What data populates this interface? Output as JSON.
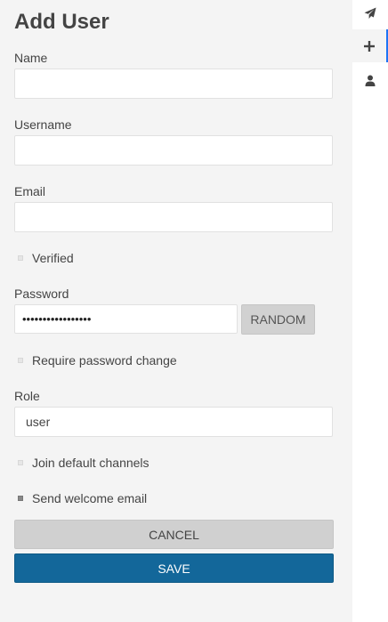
{
  "panel": {
    "title": "Add User",
    "fields": {
      "name": {
        "label": "Name",
        "value": ""
      },
      "username": {
        "label": "Username",
        "value": ""
      },
      "email": {
        "label": "Email",
        "value": ""
      },
      "password": {
        "label": "Password",
        "value": "•••••••••••••••••"
      },
      "role": {
        "label": "Role",
        "value": "user"
      }
    },
    "checkboxes": {
      "verified": {
        "label": "Verified",
        "checked": false
      },
      "require_password_change": {
        "label": "Require password change",
        "checked": false
      },
      "join_default_channels": {
        "label": "Join default channels",
        "checked": false
      },
      "send_welcome_email": {
        "label": "Send welcome email",
        "checked": true
      }
    },
    "buttons": {
      "random": "RANDOM",
      "cancel": "CANCEL",
      "save": "SAVE"
    }
  },
  "rail": {
    "items": [
      {
        "icon": "send-icon",
        "active": false
      },
      {
        "icon": "plus-icon",
        "active": true
      },
      {
        "icon": "user-icon",
        "active": false
      }
    ]
  },
  "colors": {
    "primary": "#13679a",
    "background": "#f4f4f4",
    "active_accent": "#1d74f5"
  }
}
